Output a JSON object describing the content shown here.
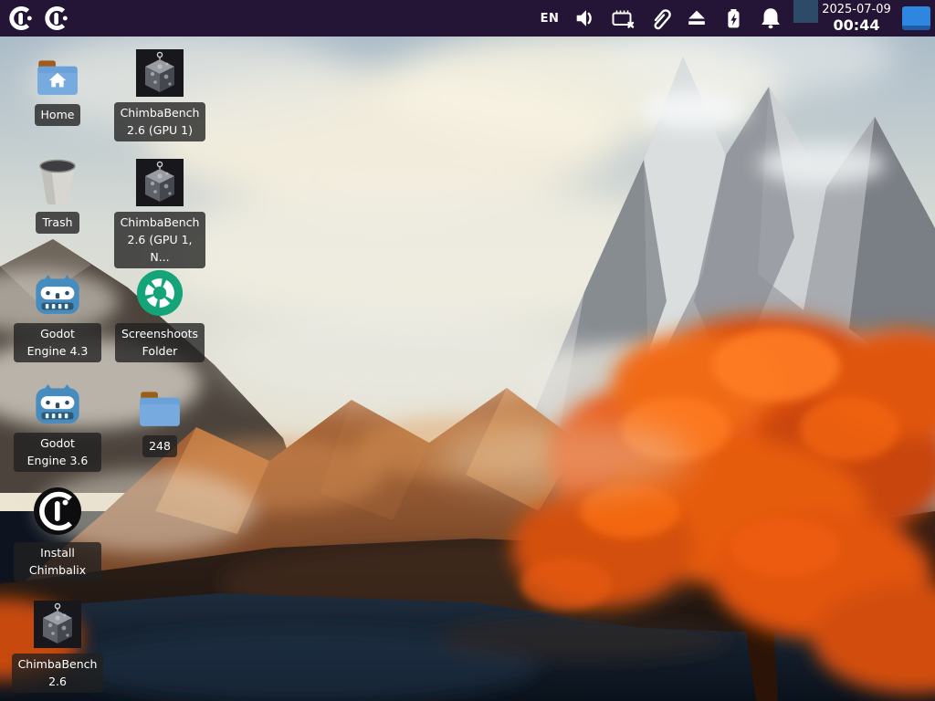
{
  "panel": {
    "language": "EN",
    "date": "2025-07-09",
    "time": "00:44",
    "tray_icons": [
      "language-indicator",
      "volume-icon",
      "card-disconnected-icon",
      "clipboard-icon",
      "eject-icon",
      "battery-charging-icon",
      "notifications-bell-icon"
    ],
    "colors": {
      "panel_bg": "#241536",
      "workspace_blue": "#2e86e0",
      "tray_square_blue": "#2d4a68"
    }
  },
  "desktop": {
    "icons": [
      {
        "icon": "home-folder-icon",
        "label": "Home"
      },
      {
        "icon": "chimbabench-cube-icon",
        "label": "ChimbaBench 2.6 (GPU 1)"
      },
      {
        "icon": "trash-icon",
        "label": "Trash"
      },
      {
        "icon": "chimbabench-cube-icon",
        "label": "ChimbaBench 2.6 (GPU 1, N..."
      },
      {
        "icon": "godot-icon",
        "label": "Godot Engine 4.3"
      },
      {
        "icon": "screenshots-folder-icon",
        "label": "Screenshoots Folder"
      },
      {
        "icon": "godot-icon",
        "label": "Godot Engine 3.6"
      },
      {
        "icon": "folder-icon",
        "label": "248"
      },
      {
        "icon": "chimbalix-installer-icon",
        "label": "Install Chimbalix"
      },
      {
        "icon": "chimbabench-cube-icon",
        "label": "ChimbaBench 2.6"
      }
    ],
    "wallpaper_colors": {
      "sky": "#a9bdcb",
      "tree_orange": "#e85a12",
      "water": "#101a26"
    }
  }
}
